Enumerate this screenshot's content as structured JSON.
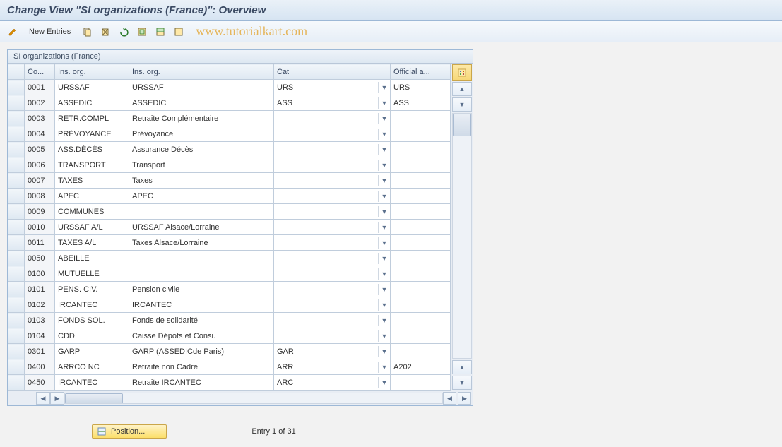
{
  "header": {
    "title": "Change View \"SI organizations (France)\": Overview"
  },
  "toolbar": {
    "new_entries_label": "New Entries"
  },
  "watermark": "www.tutorialkart.com",
  "panel": {
    "title": "SI organizations (France)",
    "columns": {
      "sel": "",
      "code": "Co...",
      "short": "Ins. org.",
      "long": "Ins. org.",
      "cat": "Cat",
      "official": "Official a..."
    }
  },
  "rows": [
    {
      "code": "0001",
      "short": "URSSAF",
      "long": "URSSAF",
      "cat": "URS",
      "official": "URS"
    },
    {
      "code": "0002",
      "short": "ASSEDIC",
      "long": "ASSEDIC",
      "cat": "ASS",
      "official": "ASS"
    },
    {
      "code": "0003",
      "short": "RETR.COMPL",
      "long": "Retraite Complémentaire",
      "cat": "",
      "official": ""
    },
    {
      "code": "0004",
      "short": "PRÉVOYANCE",
      "long": "Prévoyance",
      "cat": "",
      "official": ""
    },
    {
      "code": "0005",
      "short": "ASS.DÉCÈS",
      "long": "Assurance Décès",
      "cat": "",
      "official": ""
    },
    {
      "code": "0006",
      "short": "TRANSPORT",
      "long": "Transport",
      "cat": "",
      "official": ""
    },
    {
      "code": "0007",
      "short": "TAXES",
      "long": "Taxes",
      "cat": "",
      "official": ""
    },
    {
      "code": "0008",
      "short": "APEC",
      "long": "APEC",
      "cat": "",
      "official": ""
    },
    {
      "code": "0009",
      "short": "COMMUNES",
      "long": "",
      "cat": "",
      "official": ""
    },
    {
      "code": "0010",
      "short": "URSSAF A/L",
      "long": "URSSAF Alsace/Lorraine",
      "cat": "",
      "official": ""
    },
    {
      "code": "0011",
      "short": "TAXES A/L",
      "long": "Taxes Alsace/Lorraine",
      "cat": "",
      "official": ""
    },
    {
      "code": "0050",
      "short": "ABEILLE",
      "long": "",
      "cat": "",
      "official": ""
    },
    {
      "code": "0100",
      "short": "MUTUELLE",
      "long": "",
      "cat": "",
      "official": ""
    },
    {
      "code": "0101",
      "short": "PENS. CIV.",
      "long": "Pension civile",
      "cat": "",
      "official": ""
    },
    {
      "code": "0102",
      "short": "IRCANTEC",
      "long": "IRCANTEC",
      "cat": "",
      "official": ""
    },
    {
      "code": "0103",
      "short": "FONDS SOL.",
      "long": "Fonds de solidarité",
      "cat": "",
      "official": ""
    },
    {
      "code": "0104",
      "short": "CDD",
      "long": "Caisse Dépots et Consi.",
      "cat": "",
      "official": ""
    },
    {
      "code": "0301",
      "short": "GARP",
      "long": "GARP (ASSEDICde Paris)",
      "cat": "GAR",
      "official": ""
    },
    {
      "code": "0400",
      "short": "ARRCO NC",
      "long": "Retraite non Cadre",
      "cat": "ARR",
      "official": "A202"
    },
    {
      "code": "0450",
      "short": "IRCANTEC",
      "long": "Retraite IRCANTEC",
      "cat": "ARC",
      "official": ""
    }
  ],
  "footer": {
    "position_label": "Position...",
    "entry_status": "Entry 1 of 31"
  },
  "colors": {
    "header_bg": "#d6e4f2",
    "accent_yellow": "#fcdf6a",
    "watermark": "#e5b55a"
  }
}
